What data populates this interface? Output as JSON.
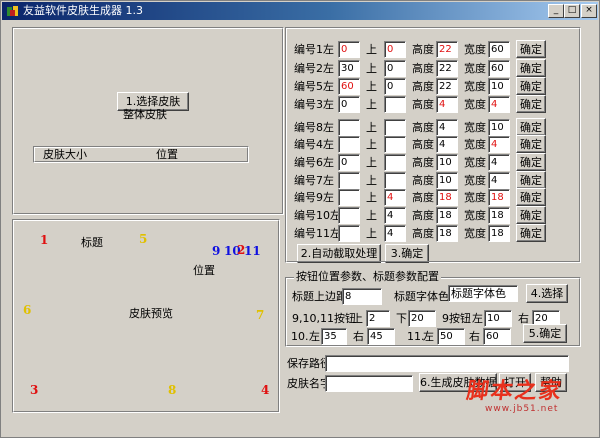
{
  "window": {
    "title": "友益软件皮肤生成器  1.3",
    "minimize": "_",
    "maximize": "□",
    "close": "×"
  },
  "skin_panel": {
    "select_button": "1.选择皮肤",
    "whole_skin_label": "整体皮肤",
    "size_label": "皮肤大小",
    "position_label": "位置"
  },
  "preview_panel": {
    "title_label": "标题",
    "position_label": "位置",
    "preview_label": "皮肤预览",
    "markers": [
      {
        "text": "1",
        "color": "#e01010"
      },
      {
        "text": "5",
        "color": "#e0c000"
      },
      {
        "text": "9",
        "color": "#1010e0"
      },
      {
        "text": "10",
        "color": "#1010e0"
      },
      {
        "text": "2",
        "color": "#e01010"
      },
      {
        "text": "11",
        "color": "#1010e0"
      },
      {
        "text": "6",
        "color": "#e0c000"
      },
      {
        "text": "7",
        "color": "#e0c000"
      },
      {
        "text": "3",
        "color": "#e01010"
      },
      {
        "text": "8",
        "color": "#e0c000"
      },
      {
        "text": "4",
        "color": "#e01010"
      }
    ]
  },
  "buttons_grid": {
    "left_suffix": "左",
    "top_label": "上",
    "height_label": "高度",
    "width_label": "宽度",
    "confirm_label": "确定",
    "rows": [
      {
        "label": "编号1",
        "left": "0",
        "left_red": true,
        "top": "0",
        "top_red": true,
        "height": "22",
        "height_red": true,
        "width": "60",
        "width_red": false
      },
      {
        "label": "编号2",
        "left": "30",
        "left_red": false,
        "top": "0",
        "top_red": false,
        "height": "22",
        "height_red": false,
        "width": "60",
        "width_red": false
      },
      {
        "label": "编号5",
        "left": "60",
        "left_red": true,
        "top": "0",
        "top_red": false,
        "height": "22",
        "height_red": false,
        "width": "10",
        "width_red": false
      },
      {
        "label": "编号3",
        "left": "0",
        "left_red": false,
        "top": "",
        "top_red": false,
        "height": "4",
        "height_red": true,
        "width": "4",
        "width_red": true
      },
      {
        "label": "编号8",
        "left": "",
        "left_red": false,
        "top": "",
        "top_red": false,
        "height": "4",
        "height_red": false,
        "width": "10",
        "width_red": false
      },
      {
        "label": "编号4",
        "left": "",
        "left_red": false,
        "top": "",
        "top_red": false,
        "height": "4",
        "height_red": false,
        "width": "4",
        "width_red": true
      },
      {
        "label": "编号6",
        "left": "0",
        "left_red": false,
        "top": "",
        "top_red": false,
        "height": "10",
        "height_red": false,
        "width": "4",
        "width_red": false
      },
      {
        "label": "编号7",
        "left": "",
        "left_red": false,
        "top": "",
        "top_red": false,
        "height": "10",
        "height_red": false,
        "width": "4",
        "width_red": false
      },
      {
        "label": "编号9",
        "left": "",
        "left_red": false,
        "top": "4",
        "top_red": true,
        "height": "18",
        "height_red": true,
        "width": "18",
        "width_red": true
      },
      {
        "label": "编号10",
        "left": "",
        "left_red": false,
        "top": "4",
        "top_red": false,
        "height": "18",
        "height_red": false,
        "width": "18",
        "width_red": false
      },
      {
        "label": "编号11",
        "left": "",
        "left_red": false,
        "top": "4",
        "top_red": false,
        "height": "18",
        "height_red": false,
        "width": "18",
        "width_red": false
      }
    ],
    "auto_button": "2.自动截取处理",
    "confirm3_button": "3.确定"
  },
  "title_params": {
    "group_title": "按钮位置参数、标题参数配置",
    "title_top_label": "标题上边距",
    "title_top_value": "8",
    "font_color_label": "标题字体色",
    "font_color_value": "标题字体色",
    "choose_button": "4.选择",
    "btn91011_label": "9,10,11按钮",
    "top_label": "上",
    "top_value": "2",
    "bottom_label": "下",
    "bottom_value": "20",
    "btn9_label": "9按钮",
    "left_label": "左",
    "btn9_left": "10",
    "right_label": "右",
    "btn9_right": "20",
    "btn10_label": "10.",
    "btn10_left_label": "左",
    "btn10_left": "35",
    "btn10_right_label": "右",
    "btn10_right": "45",
    "btn11_label": "11.",
    "btn11_left_label": "左",
    "btn11_left": "50",
    "btn11_right_label": "右",
    "btn11_right": "60",
    "confirm5_button": "5.确定"
  },
  "save": {
    "path_label": "保存路径",
    "path_value": "",
    "name_label": "皮肤名字",
    "name_value": "",
    "generate_button": "6.生成皮肤数据",
    "open_button": "打开",
    "help_button": "帮助"
  },
  "watermark": {
    "text": "脚本之家",
    "url": "www.jb51.net"
  }
}
